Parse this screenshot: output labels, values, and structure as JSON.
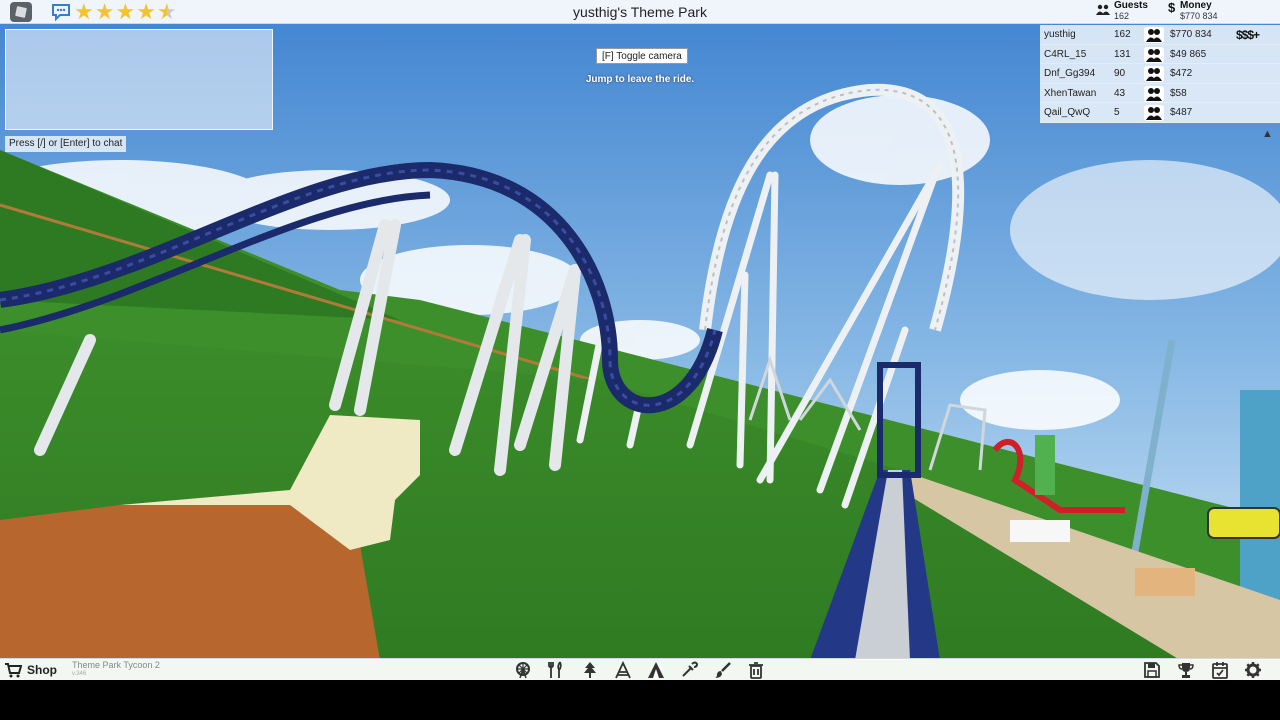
{
  "window": {
    "title": "yusthig's Theme Park"
  },
  "header": {
    "rating_stars": 4.5,
    "guests": {
      "label": "Guests",
      "value": "162"
    },
    "money": {
      "label": "Money",
      "value": "$770 834"
    }
  },
  "chat": {
    "hint": "Press [/] or [Enter] to chat"
  },
  "ride_overlay": {
    "toggle_camera": "[F] Toggle camera",
    "jump_hint": "Jump to leave the ride."
  },
  "leaderboard": {
    "cash_button": "$$$+",
    "rows": [
      {
        "name": "yusthig",
        "guests": "162",
        "money": "$770 834"
      },
      {
        "name": "C4RL_15",
        "guests": "131",
        "money": "$49 865"
      },
      {
        "name": "Dnf_Gg394",
        "guests": "90",
        "money": "$472"
      },
      {
        "name": "XhenTawan",
        "guests": "43",
        "money": "$58"
      },
      {
        "name": "Qail_QwQ",
        "guests": "5",
        "money": "$487"
      }
    ]
  },
  "bottombar": {
    "shop_label": "Shop",
    "game_name": "Theme Park Tycoon 2",
    "version": "v.346",
    "build_tools": [
      "ferris-wheel-icon",
      "food-icon",
      "tree-icon",
      "ride-icon",
      "tent-icon",
      "pipette-icon",
      "paint-brush-icon",
      "trash-icon"
    ],
    "right_tools": [
      "save-icon",
      "trophy-icon",
      "calendar-icon",
      "settings-icon"
    ]
  },
  "colors": {
    "sky": "#6aa3dc",
    "grass": "#3f8f2a",
    "track_blue": "#1b2a6b",
    "support_white": "#e8ecef",
    "star": "#f4c430"
  }
}
